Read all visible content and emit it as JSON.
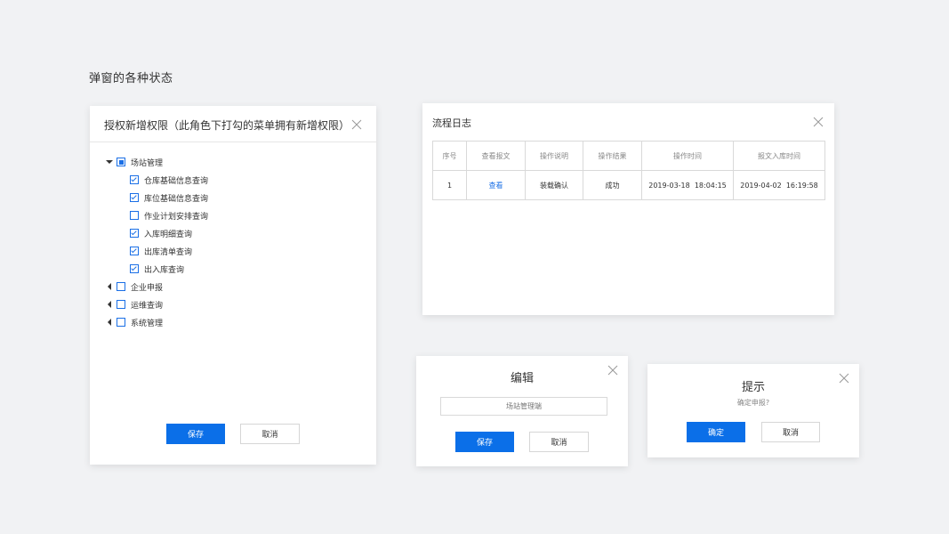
{
  "page": {
    "title": "弹窗的各种状态"
  },
  "colors": {
    "primary": "#0b6fe8",
    "link": "#1a6fe6",
    "background": "#f1f2f4"
  },
  "auth_dialog": {
    "title": "授权新增权限（此角色下打勾的菜单拥有新增权限）",
    "tree": {
      "root": {
        "label": "场站管理",
        "state": "partial",
        "expanded": true
      },
      "children": [
        {
          "label": "仓库基础信息查询",
          "checked": true
        },
        {
          "label": "库位基础信息查询",
          "checked": true
        },
        {
          "label": "作业计划安排查询",
          "checked": false
        },
        {
          "label": "入库明细查询",
          "checked": true
        },
        {
          "label": "出库清单查询",
          "checked": true
        },
        {
          "label": "出入库查询",
          "checked": true
        }
      ],
      "collapsed_groups": [
        {
          "label": "企业申报"
        },
        {
          "label": "运维查询"
        },
        {
          "label": "系统管理"
        }
      ]
    },
    "save_label": "保存",
    "cancel_label": "取消"
  },
  "log_dialog": {
    "title": "流程日志",
    "columns": [
      "序号",
      "查看报文",
      "操作说明",
      "操作结果",
      "操作时间",
      "报文入库时间"
    ],
    "rows": [
      [
        "1",
        "查看",
        "装载确认",
        "成功",
        "2019-03-18  18:04:15",
        "2019-04-02  16:19:58"
      ]
    ]
  },
  "edit_dialog": {
    "title": "编辑",
    "input_placeholder": "场站管理端",
    "save_label": "保存",
    "cancel_label": "取消"
  },
  "tip_dialog": {
    "title": "提示",
    "message": "确定申报?",
    "confirm_label": "确定",
    "cancel_label": "取消"
  }
}
